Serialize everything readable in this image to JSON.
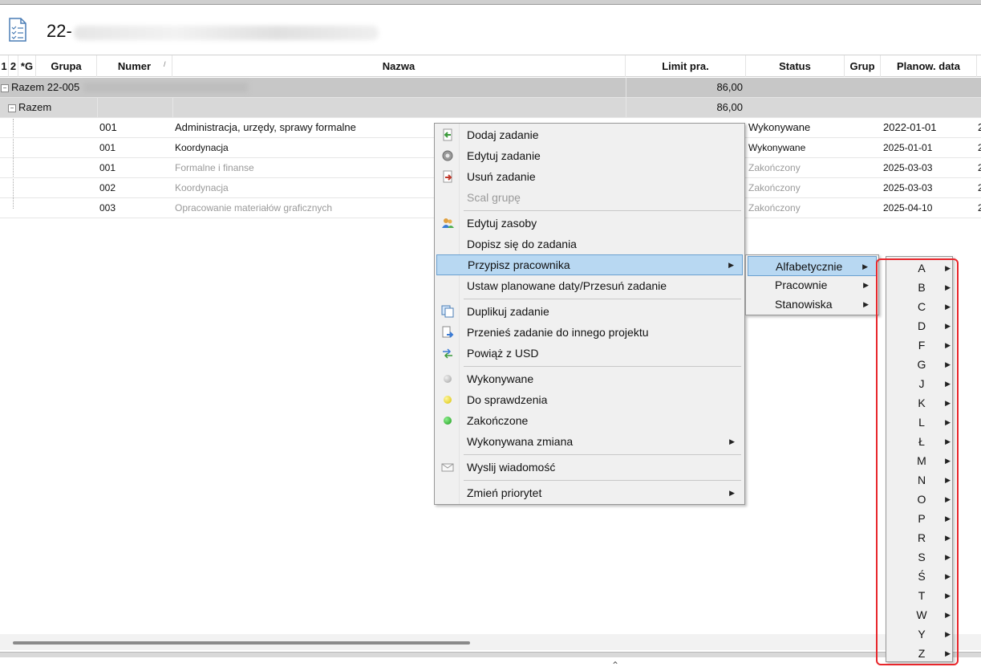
{
  "header": {
    "title": "22-"
  },
  "grid": {
    "columns": {
      "c1": "1",
      "c2": "2",
      "c3": "*G",
      "grupa": "Grupa",
      "numer": "Numer",
      "nazwa": "Nazwa",
      "limit": "Limit pra.",
      "status": "Status",
      "grup": "Grup",
      "planow": "Planow. data"
    },
    "sort_mark": "/",
    "groups": [
      {
        "label": "Razem 22-005",
        "value": "86,00"
      },
      {
        "label": "Razem",
        "value": "86,00"
      }
    ],
    "rows": [
      {
        "numer": "001",
        "nazwa": "Administracja, urzędy, sprawy formalne",
        "status": "Wykonywane",
        "data": "2022-01-01",
        "done": false
      },
      {
        "numer": "001",
        "nazwa": "Koordynacja",
        "status": "Wykonywane",
        "data": "2025-01-01",
        "done": false
      },
      {
        "numer": "001",
        "nazwa": "Formalne i finanse",
        "status": "Zakończony",
        "data": "2025-03-03",
        "done": true
      },
      {
        "numer": "002",
        "nazwa": "Koordynacja",
        "status": "Zakończony",
        "data": "2025-03-03",
        "done": true
      },
      {
        "numer": "003",
        "nazwa": "Opracowanie  materiałów graficznych",
        "status": "Zakończony",
        "data": "2025-04-10",
        "done": true
      }
    ],
    "trailing_char": "2"
  },
  "context_menu": {
    "items": [
      {
        "label": "Dodaj zadanie",
        "icon": "add-task-icon"
      },
      {
        "label": "Edytuj zadanie",
        "icon": "gear-icon"
      },
      {
        "label": "Usuń zadanie",
        "icon": "delete-task-icon"
      },
      {
        "label": "Scal grupę",
        "icon": ""
      },
      {
        "label": "Edytuj zasoby",
        "icon": "users-icon"
      },
      {
        "label": "Dopisz się do zadania",
        "icon": ""
      },
      {
        "label": "Przypisz pracownika",
        "icon": ""
      },
      {
        "label": "Ustaw planowane daty/Przesuń zadanie",
        "icon": ""
      },
      {
        "label": "Duplikuj zadanie",
        "icon": "duplicate-icon"
      },
      {
        "label": "Przenieś zadanie do innego projektu",
        "icon": "move-document-icon"
      },
      {
        "label": "Powiąż z USD",
        "icon": "link-arrows-icon"
      },
      {
        "label": "Wykonywane",
        "icon": "gray-dot-icon"
      },
      {
        "label": "Do sprawdzenia",
        "icon": "yellow-dot-icon"
      },
      {
        "label": "Zakończone",
        "icon": "green-dot-icon"
      },
      {
        "label": "Wykonywana zmiana",
        "icon": ""
      },
      {
        "label": "Wyslij wiadomość",
        "icon": "envelope-icon"
      },
      {
        "label": "Zmień priorytet",
        "icon": ""
      }
    ]
  },
  "assign_submenu": {
    "items": [
      "Alfabetycznie",
      "Pracownie",
      "Stanowiska"
    ]
  },
  "letters": [
    "A",
    "B",
    "C",
    "D",
    "F",
    "G",
    "J",
    "K",
    "L",
    "Ł",
    "M",
    "N",
    "O",
    "P",
    "R",
    "S",
    "Ś",
    "T",
    "W",
    "Y",
    "Z"
  ],
  "colors": {
    "highlight": "#b8d8f2",
    "annotation_frame": "#e8262b",
    "group_row": "#c7c7c7"
  }
}
